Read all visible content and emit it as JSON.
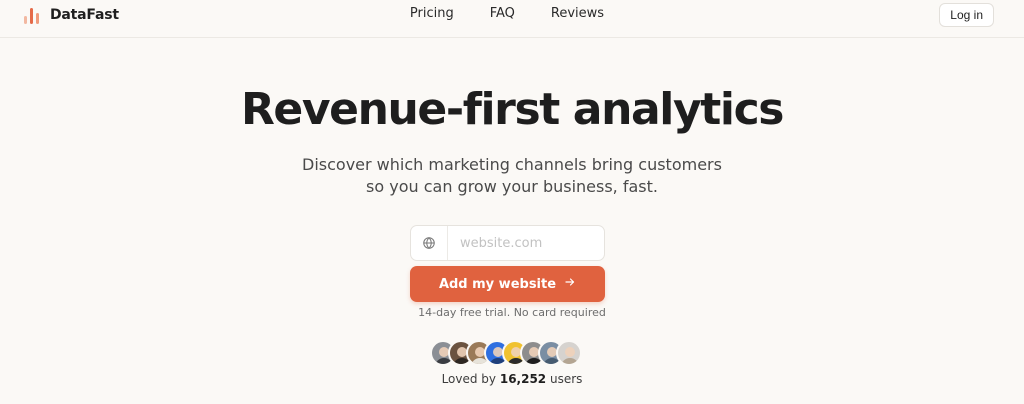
{
  "brand": {
    "name": "DataFast",
    "colors": {
      "accent": "#e0623f"
    }
  },
  "nav": {
    "links": [
      "Pricing",
      "FAQ",
      "Reviews"
    ],
    "login_label": "Log in"
  },
  "hero": {
    "headline": "Revenue-first analytics",
    "subtitle_line1": "Discover which marketing channels bring customers",
    "subtitle_line2": "so you can grow your business, fast."
  },
  "form": {
    "url_icon": "globe-icon",
    "url_placeholder": "website.com",
    "url_value": "",
    "cta_label": "Add my website",
    "cta_icon": "arrow-right-icon",
    "trial_note": "14-day free trial. No card required"
  },
  "social_proof": {
    "avatar_count": 8,
    "loved_prefix": "Loved by",
    "user_count": "16,252",
    "loved_suffix": "users"
  }
}
